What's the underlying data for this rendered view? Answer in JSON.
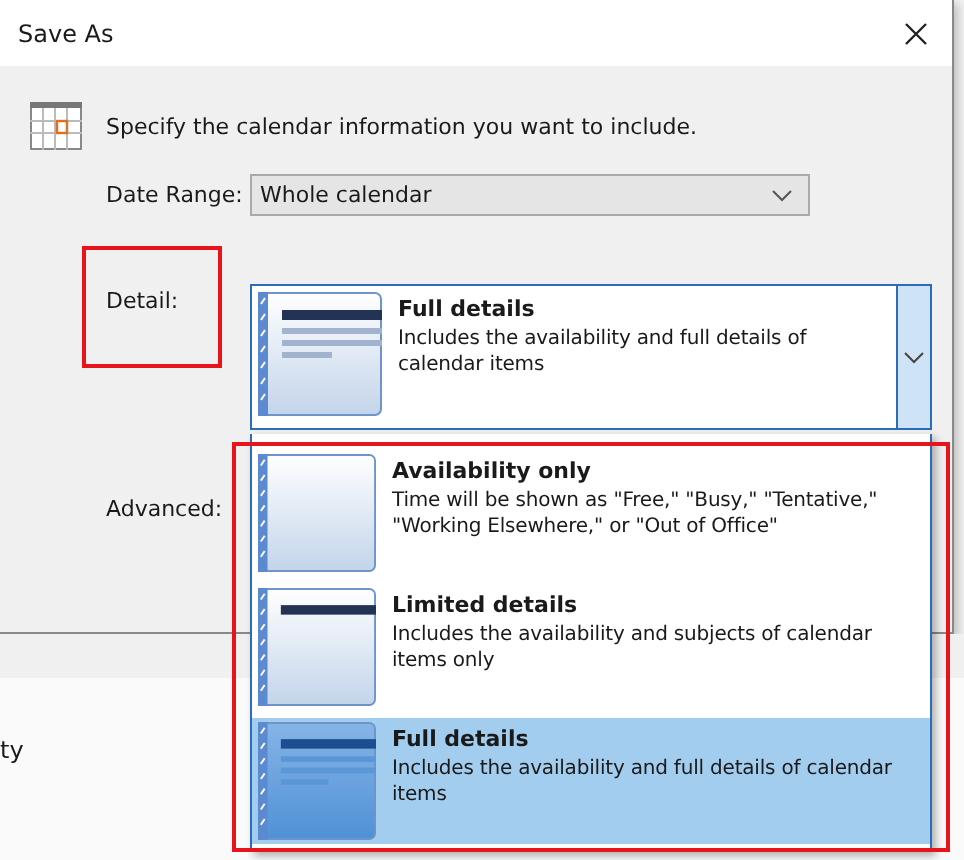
{
  "window": {
    "title": "Save As"
  },
  "prompt": "Specify the calendar information you want to include.",
  "date_range": {
    "label": "Date Range:",
    "value": "Whole calendar"
  },
  "detail": {
    "label": "Detail:",
    "expanded": true,
    "value": {
      "kind": "full",
      "title": "Full details",
      "description": "Includes the availability and full details of calendar items"
    }
  },
  "advanced": {
    "label": "Advanced:"
  },
  "options": [
    {
      "kind": "availability",
      "title": "Availability only",
      "description": "Time will be shown as \"Free,\" \"Busy,\" \"Tentative,\" \"Working Elsewhere,\" or \"Out of Office\"",
      "selected": false
    },
    {
      "kind": "limited",
      "title": "Limited details",
      "description": "Includes the availability and subjects of calendar items only",
      "selected": false
    },
    {
      "kind": "full",
      "title": "Full details",
      "description": "Includes the availability and full details of calendar items",
      "selected": true
    }
  ],
  "background": {
    "text": "ty"
  }
}
